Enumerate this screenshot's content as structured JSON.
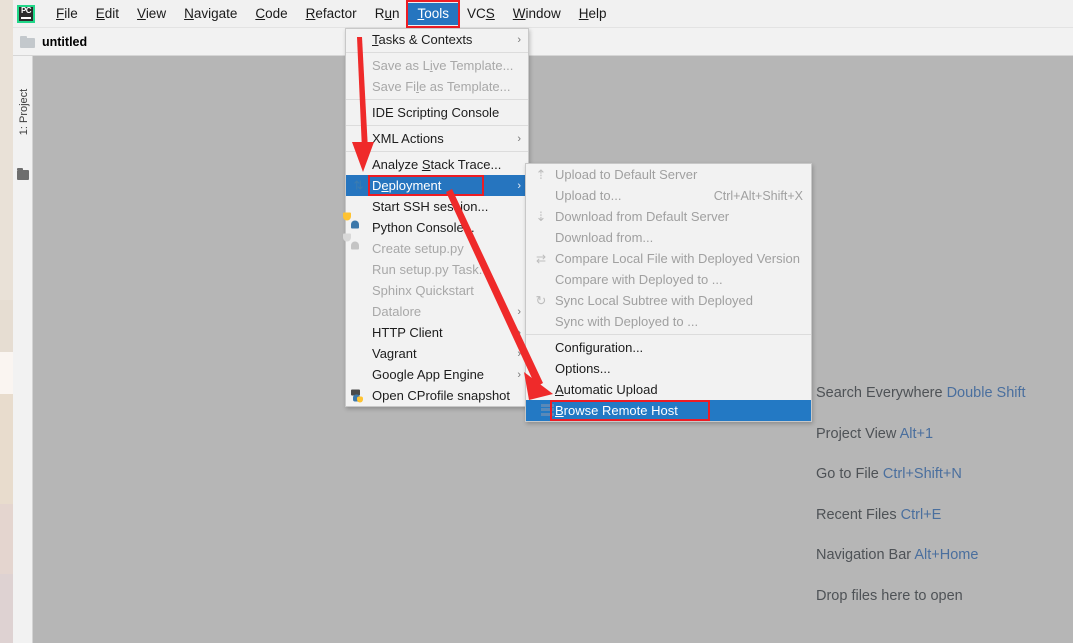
{
  "app": {
    "logo_text": "PC",
    "project_tab_label": "untitled",
    "tool_window_label": "1: Project"
  },
  "menubar": {
    "items": [
      {
        "label": "File",
        "mnemonic": "F"
      },
      {
        "label": "Edit",
        "mnemonic": "E"
      },
      {
        "label": "View",
        "mnemonic": "V"
      },
      {
        "label": "Navigate",
        "mnemonic": "N"
      },
      {
        "label": "Code",
        "mnemonic": "C"
      },
      {
        "label": "Refactor",
        "mnemonic": "R"
      },
      {
        "label": "Run",
        "mnemonic": "u"
      },
      {
        "label": "Tools",
        "mnemonic": "T",
        "selected": true,
        "annotated": true
      },
      {
        "label": "VCS",
        "mnemonic": "S"
      },
      {
        "label": "Window",
        "mnemonic": "W"
      },
      {
        "label": "Help",
        "mnemonic": "H"
      }
    ]
  },
  "tools_menu": {
    "items": [
      {
        "label": "Tasks & Contexts",
        "mnemonic": "T",
        "enabled": true,
        "submenu": true,
        "icon": "none"
      },
      {
        "separator": true
      },
      {
        "label": "Save as Live Template...",
        "mnemonic": "i",
        "enabled": false,
        "icon": "none"
      },
      {
        "label": "Save File as Template...",
        "mnemonic": "l",
        "enabled": false,
        "icon": "none"
      },
      {
        "separator": true
      },
      {
        "label": "IDE Scripting Console",
        "enabled": true,
        "icon": "none"
      },
      {
        "separator": true
      },
      {
        "label": "XML Actions",
        "enabled": true,
        "submenu": true,
        "icon": "none"
      },
      {
        "separator": true
      },
      {
        "label": "Analyze Stack Trace...",
        "mnemonic": "S",
        "enabled": true,
        "icon": "none"
      },
      {
        "label": "Deployment",
        "mnemonic": "e",
        "enabled": true,
        "submenu": true,
        "selected": true,
        "annotated": true,
        "icon": "deployment-icon"
      },
      {
        "label": "Start SSH session...",
        "enabled": true,
        "icon": "none"
      },
      {
        "label": "Python Console...",
        "enabled": true,
        "icon": "python-icon"
      },
      {
        "label": "Create setup.py",
        "enabled": false,
        "icon": "python-icon-disabled"
      },
      {
        "label": "Run setup.py Task...",
        "enabled": false,
        "icon": "none"
      },
      {
        "label": "Sphinx Quickstart",
        "enabled": false,
        "icon": "none"
      },
      {
        "label": "Datalore",
        "enabled": false,
        "submenu": true,
        "icon": "none"
      },
      {
        "label": "HTTP Client",
        "enabled": true,
        "submenu": true,
        "icon": "none"
      },
      {
        "label": "Vagrant",
        "enabled": true,
        "submenu": true,
        "icon": "none"
      },
      {
        "label": "Google App Engine",
        "enabled": true,
        "submenu": true,
        "icon": "none"
      },
      {
        "label": "Open CProfile snapshot",
        "enabled": true,
        "icon": "cprofile-icon"
      }
    ]
  },
  "deployment_submenu": {
    "items": [
      {
        "label": "Upload to Default Server",
        "enabled": false,
        "icon": "upload-icon",
        "shortcut": ""
      },
      {
        "label": "Upload to...",
        "enabled": false,
        "icon": "none",
        "shortcut": "Ctrl+Alt+Shift+X"
      },
      {
        "label": "Download from Default Server",
        "enabled": false,
        "icon": "download-icon",
        "shortcut": ""
      },
      {
        "label": "Download from...",
        "enabled": false,
        "icon": "none",
        "shortcut": ""
      },
      {
        "label": "Compare Local File with Deployed Version",
        "enabled": false,
        "icon": "compare-icon",
        "shortcut": ""
      },
      {
        "label": "Compare with Deployed to ...",
        "enabled": false,
        "icon": "none",
        "shortcut": ""
      },
      {
        "label": "Sync Local Subtree with Deployed",
        "enabled": false,
        "icon": "sync-icon",
        "shortcut": ""
      },
      {
        "label": "Sync with Deployed to ...",
        "enabled": false,
        "icon": "none",
        "shortcut": ""
      },
      {
        "separator": true
      },
      {
        "label": "Configuration...",
        "enabled": true,
        "icon": "none",
        "shortcut": ""
      },
      {
        "label": "Options...",
        "enabled": true,
        "icon": "none",
        "shortcut": ""
      },
      {
        "label": "Automatic Upload",
        "mnemonic": "A",
        "enabled": true,
        "icon": "none",
        "shortcut": ""
      },
      {
        "label": "Browse Remote Host",
        "mnemonic": "B",
        "enabled": true,
        "icon": "remote-host-icon",
        "shortcut": "",
        "selected": true,
        "annotated": true
      }
    ]
  },
  "editor_hints": [
    {
      "action": "Search Everywhere",
      "key": "Double Shift"
    },
    {
      "action": "Project View",
      "key": "Alt+1"
    },
    {
      "action": "Go to File",
      "key": "Ctrl+Shift+N"
    },
    {
      "action": "Recent Files",
      "key": "Ctrl+E"
    },
    {
      "action": "Navigation Bar",
      "key": "Alt+Home"
    },
    {
      "action": "Drop files here to open",
      "key": ""
    }
  ],
  "annotations": {
    "arrow_color": "#ef2a2a",
    "box_color": "#ec1c24",
    "arrow1_target": "Deployment",
    "arrow2_target": "Browse Remote Host"
  },
  "colors": {
    "selection_blue": "#2675bf",
    "submenu_selection_blue": "#2379c4",
    "menu_bg": "#f2f2f2",
    "editor_bg": "#b6b6b6",
    "hint_key": "#4a6f9e"
  }
}
